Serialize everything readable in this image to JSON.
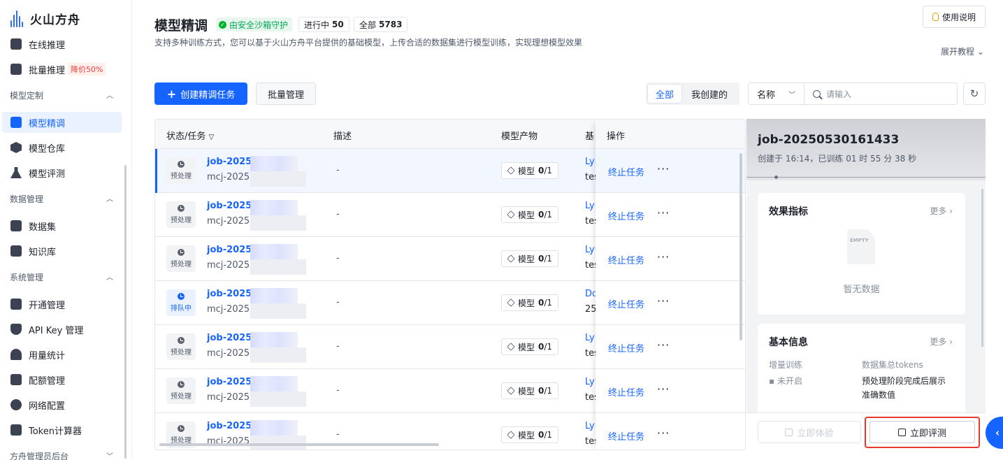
{
  "brand": {
    "name": "火山方舟"
  },
  "sidebar": {
    "top_items": [
      {
        "label": "在线推理",
        "icon": "bar-chart-icon"
      },
      {
        "label": "批量推理",
        "icon": "rocket-icon",
        "badge": "降价50%"
      }
    ],
    "sections": [
      {
        "title": "模型定制",
        "items": [
          {
            "label": "模型精调",
            "icon": "tune-icon",
            "active": true
          },
          {
            "label": "模型仓库",
            "icon": "cube-icon"
          },
          {
            "label": "模型评测",
            "icon": "flask-icon"
          }
        ]
      },
      {
        "title": "数据管理",
        "items": [
          {
            "label": "数据集",
            "icon": "dataset-icon"
          },
          {
            "label": "知识库",
            "icon": "database-icon"
          }
        ]
      },
      {
        "title": "系统管理",
        "items": [
          {
            "label": "开通管理",
            "icon": "clipboard-icon"
          },
          {
            "label": "API Key 管理",
            "icon": "shield-icon"
          },
          {
            "label": "用量统计",
            "icon": "gauge-icon"
          },
          {
            "label": "配额管理",
            "icon": "quota-icon"
          },
          {
            "label": "网络配置",
            "icon": "globe-icon"
          },
          {
            "label": "Token计算器",
            "icon": "calculator-icon"
          }
        ]
      },
      {
        "title": "方舟管理员后台",
        "items": []
      }
    ]
  },
  "header": {
    "title": "模型精调",
    "safe_tag": "由安全沙箱守护",
    "running_label": "进行中",
    "running_count": "50",
    "total_label": "全部",
    "total_count": "5783",
    "description": "支持多种训练方式，您可以基于火山方舟平台提供的基础模型，上传合适的数据集进行模型训练，实现理想模型效果",
    "help_button": "使用说明",
    "expand_link": "展开教程"
  },
  "toolbar": {
    "create_button": "创建精调任务",
    "batch_button": "批量管理",
    "scope_all": "全部",
    "scope_mine": "我创建的",
    "filter_field": "名称",
    "search_placeholder": "请输入"
  },
  "table": {
    "columns": {
      "status_task": "状态/任务",
      "description": "描述",
      "artifacts": "模型产物",
      "base": "基",
      "actions": "操作"
    },
    "rows": [
      {
        "status": "预处理",
        "job": "job-20250",
        "sub": "mcj-20250",
        "desc": "-",
        "model_label": "模型",
        "model_done": "0",
        "model_total": "/1",
        "base1": "Lyh",
        "base2": "tes",
        "stop": "终止任务",
        "more": "···"
      },
      {
        "status": "预处理",
        "job": "job-20250",
        "sub": "mcj-20250",
        "desc": "-",
        "model_label": "模型",
        "model_done": "0",
        "model_total": "/1",
        "base1": "Lyh",
        "base2": "tes",
        "stop": "终止任务",
        "more": "···"
      },
      {
        "status": "预处理",
        "job": "job-20250",
        "sub": "mcj-20250",
        "desc": "-",
        "model_label": "模型",
        "model_done": "0",
        "model_total": "/1",
        "base1": "Lyh",
        "base2": "tes",
        "stop": "终止任务",
        "more": "···"
      },
      {
        "status": "排队中",
        "job": "job-20250",
        "sub": "mcj-20250",
        "desc": "-",
        "model_label": "模型",
        "model_done": "0",
        "model_total": "/1",
        "base1": "Do",
        "base2": "25",
        "stop": "终止任务",
        "more": "···"
      },
      {
        "status": "预处理",
        "job": "job-20250",
        "sub": "mcj-20250",
        "desc": "-",
        "model_label": "模型",
        "model_done": "0",
        "model_total": "/1",
        "base1": "Lyh",
        "base2": "tes",
        "stop": "终止任务",
        "more": "···"
      },
      {
        "status": "预处理",
        "job": "job-20250",
        "sub": "mcj-20250",
        "desc": "-",
        "model_label": "模型",
        "model_done": "0",
        "model_total": "/1",
        "base1": "Lyh",
        "base2": "tes",
        "stop": "终止任务",
        "more": "···"
      },
      {
        "status": "预处理",
        "job": "job-20250",
        "sub": "mcj-20250",
        "desc": "-",
        "model_label": "模型",
        "model_done": "0",
        "model_total": "/1",
        "base1": "Lyh",
        "base2": "tes",
        "stop": "终止任务",
        "more": "···"
      }
    ]
  },
  "panel": {
    "job_title": "job-20250530161433",
    "subtitle": "创建于 16:14，已训练 01 时 55 分 38 秒",
    "metrics": {
      "title": "效果指标",
      "more": "更多",
      "empty_badge": "EMPTY",
      "empty_text": "暂无数据"
    },
    "basic": {
      "title": "基本信息",
      "more": "更多",
      "incremental_label": "增量训练",
      "incremental_value": "未开启",
      "tokens_label": "数据集总tokens",
      "tokens_value_line1": "预处理阶段完成后展示",
      "tokens_value_line2": "准确数值"
    },
    "try_button": "立即体验",
    "eval_button": "立即评测"
  },
  "colors": {
    "primary": "#1664ff",
    "highlight": "#e8392d",
    "safe": "#00b42a"
  }
}
